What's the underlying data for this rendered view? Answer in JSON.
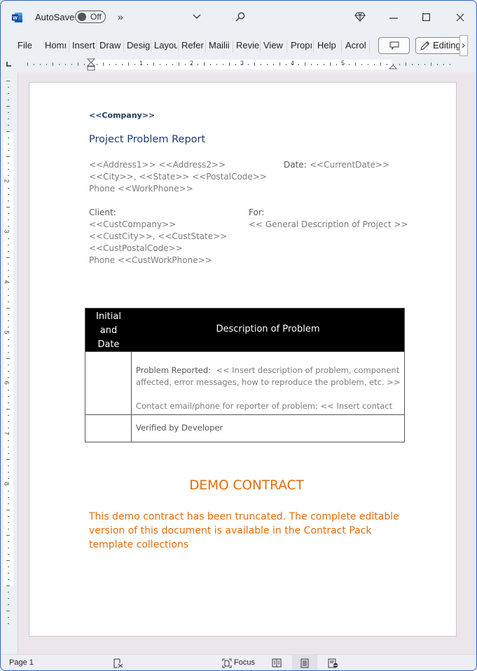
{
  "titlebar": {
    "app_icon": "word-icon",
    "autosave_label": "AutoSave",
    "autosave_state": "Off",
    "more_commands": "»",
    "customize_icon": "chevron-down-icon",
    "search_icon": "search-icon",
    "premium_icon": "diamond-icon",
    "minimize_icon": "minimize-icon",
    "maximize_icon": "maximize-icon",
    "close_icon": "close-icon"
  },
  "ribbon": {
    "tabs": [
      "File",
      "Home",
      "Insert",
      "Draw",
      "Design",
      "Layout",
      "References",
      "Mailings",
      "Review",
      "View",
      "Properties",
      "Help",
      "Acrobat"
    ],
    "tabs_visible": [
      "File",
      "Homı",
      "Insert",
      "Draw",
      "Desig",
      "Layou",
      "Refer",
      "Mailii",
      "Revie",
      "View",
      "Propı",
      "Help",
      "Acrol"
    ],
    "comment_icon": "comment-icon",
    "editing_label": "Editing",
    "editing_icon": "pencil-icon",
    "overflow_icon": "chevron-right-icon"
  },
  "ruler": {
    "horizontal_numbers": [
      "1",
      "2",
      "3",
      "4",
      "5"
    ],
    "vertical_numbers": [
      "1",
      "2",
      "3",
      "4",
      "5",
      "6",
      "7",
      "8"
    ]
  },
  "document": {
    "company": "<<Company>>",
    "title": "Project Problem Report",
    "address_lines": [
      "<<Address1>> <<Address2>>",
      "<<City>>, <<State>> <<PostalCode>>",
      "Phone <<WorkPhone>>"
    ],
    "date_label": "Date:",
    "date_value": "<<CurrentDate>>",
    "client_label": "Client:",
    "client_lines": [
      "<<CustCompany>>",
      "<<CustCity>>, <<CustState>>",
      "<<CustPostalCode>>",
      "Phone <<CustWorkPhone>>"
    ],
    "for_label": "For:",
    "for_value": "<< General Description of Project >>",
    "table": {
      "headers": [
        "Initial\nand\nDate",
        "Description of Problem"
      ],
      "header_lines": [
        "Initial",
        "and",
        "Date"
      ],
      "header_desc": "Description of Problem",
      "row1": {
        "problem_label": "Problem Reported:",
        "problem_text_line1": "<< Insert description of problem, component",
        "problem_text_line2": "affected, error messages, how to reproduce the problem, etc. >>",
        "contact_text": "Contact email/phone for reporter of problem:  << Insert contact"
      },
      "row2": {
        "verified": "Verified by Developer"
      }
    },
    "demo_title": "DEMO CONTRACT",
    "demo_lines": [
      "This demo contract has been truncated. The complete editable",
      "version of this document is available in the Contract Pack",
      "template collections"
    ]
  },
  "statusbar": {
    "page": "Page 1",
    "proofing_icon": "proofing-icon",
    "focus_label": "Focus",
    "focus_icon": "focus-icon",
    "read_mode_icon": "read-mode-icon",
    "print_layout_icon": "print-layout-icon",
    "web_layout_icon": "web-layout-icon"
  },
  "colors": {
    "accent_blue": "#2b579a",
    "title_navy": "#1f3a68",
    "demo_orange": "#e36c0a",
    "window_border": "#2b63c5"
  }
}
